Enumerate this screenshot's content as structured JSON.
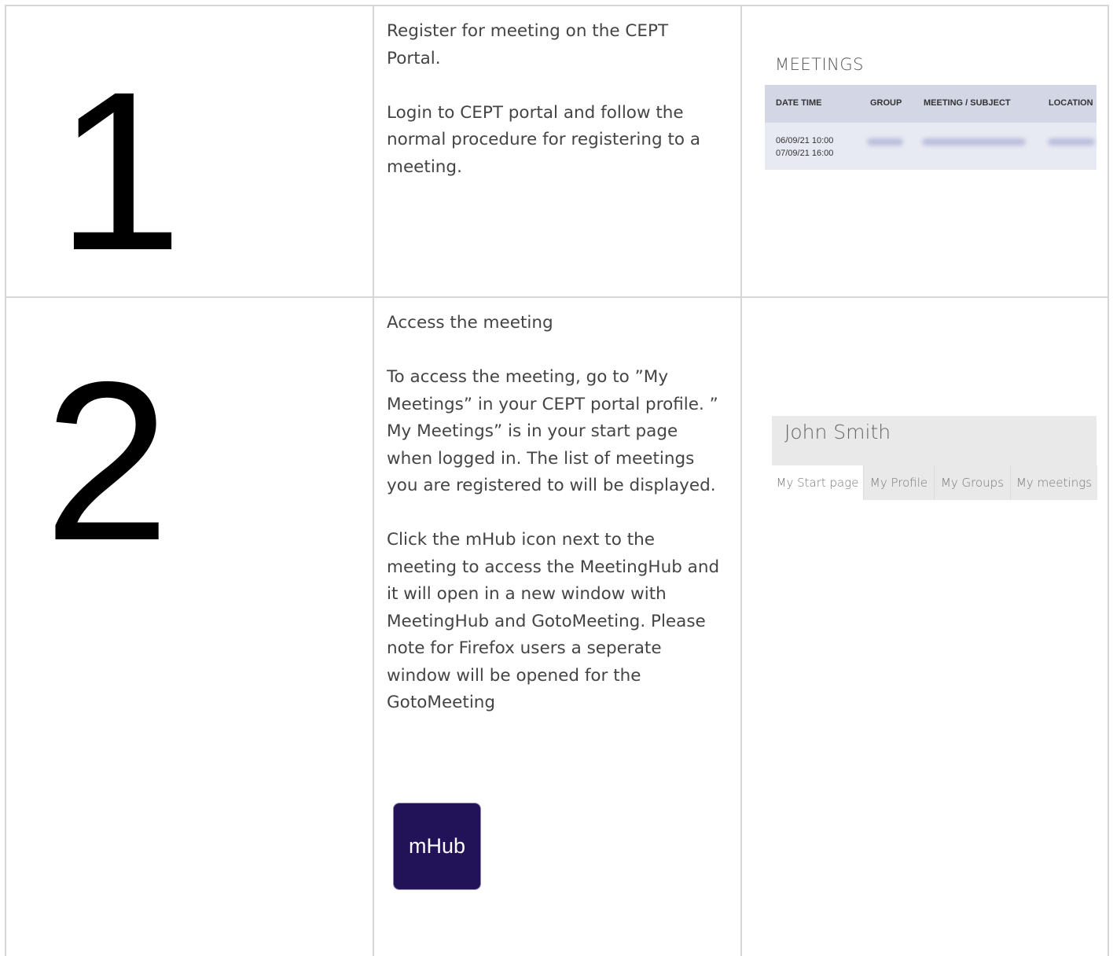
{
  "steps": [
    {
      "number": "1",
      "heading": "Register for meeting on the CEPT Portal.",
      "body": "Login to CEPT portal and follow the normal procedure for registering to a meeting."
    },
    {
      "number": "2",
      "heading": "Access the meeting",
      "body": "To access the meeting, go to  ”My Meetings” in your CEPT portal profile. ” My Meetings” is in your start page when logged in. The list of meetings you are registered to will be displayed.",
      "body2": "Click the mHub icon next to the meeting to access the MeetingHub and it will open in a new window with MeetingHub and GotoMeeting. Please note for Firefox users a seperate window will be opened for the GotoMeeting"
    }
  ],
  "meetings_panel": {
    "title": "MEETINGS",
    "columns": [
      "DATE  TIME",
      "GROUP",
      "MEETING / SUBJECT",
      "LOCATION"
    ],
    "row": {
      "start": "06/09/21 10:00",
      "end": "07/09/21 16:00"
    }
  },
  "profile_panel": {
    "name": "John Smith",
    "tabs": [
      "My Start page",
      "My Profile",
      "My Groups",
      "My meetings"
    ]
  },
  "mhub_icon": {
    "label": "mHub",
    "background": "#221258"
  },
  "colors": {
    "grid_line": "#d6d6d6",
    "table_header": "#d3d6e5",
    "table_row": "#e8eaf3",
    "profile_bar": "#e9e9e9"
  }
}
